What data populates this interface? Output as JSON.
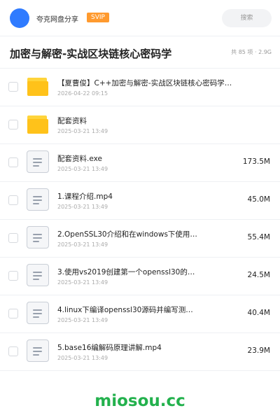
{
  "header": {
    "share_name": "夸克网盘分享",
    "badge": "SVIP",
    "search_placeholder": "搜索"
  },
  "title": {
    "text": "加密与解密-实战区块链核心密码学",
    "summary": "共 85 项 · 2.9G"
  },
  "files": [
    {
      "name": "【夏曹俊】C++加密与解密-实战区块链核心密码学…",
      "date": "2026-04-22 09:15",
      "size": "",
      "icon": "folder-icon"
    },
    {
      "name": "配套资料",
      "date": "2025-03-21 13:49",
      "size": "",
      "icon": "folder-icon"
    },
    {
      "name": "配套资料.exe",
      "date": "2025-03-21 13:49",
      "size": "173.5M",
      "icon": "file-icon"
    },
    {
      "name": "1.课程介绍.mp4",
      "date": "2025-03-21 13:49",
      "size": "45.0M",
      "icon": "file-icon"
    },
    {
      "name": "2.OpenSSL30介绍和在windows下使用…",
      "date": "2025-03-21 13:49",
      "size": "55.4M",
      "icon": "file-icon"
    },
    {
      "name": "3.使用vs2019创建第一个openssl30的…",
      "date": "2025-03-21 13:49",
      "size": "24.5M",
      "icon": "file-icon"
    },
    {
      "name": "4.linux下编译openssl30源码并编写测…",
      "date": "2025-03-21 13:49",
      "size": "40.4M",
      "icon": "file-icon"
    },
    {
      "name": "5.base16编解码原理讲解.mp4",
      "date": "2025-03-21 13:49",
      "size": "23.9M",
      "icon": "file-icon"
    }
  ],
  "watermark": "miosou.cc",
  "colors": {
    "accent": "#2f7bff",
    "badge": "#ff9a2e",
    "folder": "#ffc21a",
    "watermark": "#23b14d"
  }
}
